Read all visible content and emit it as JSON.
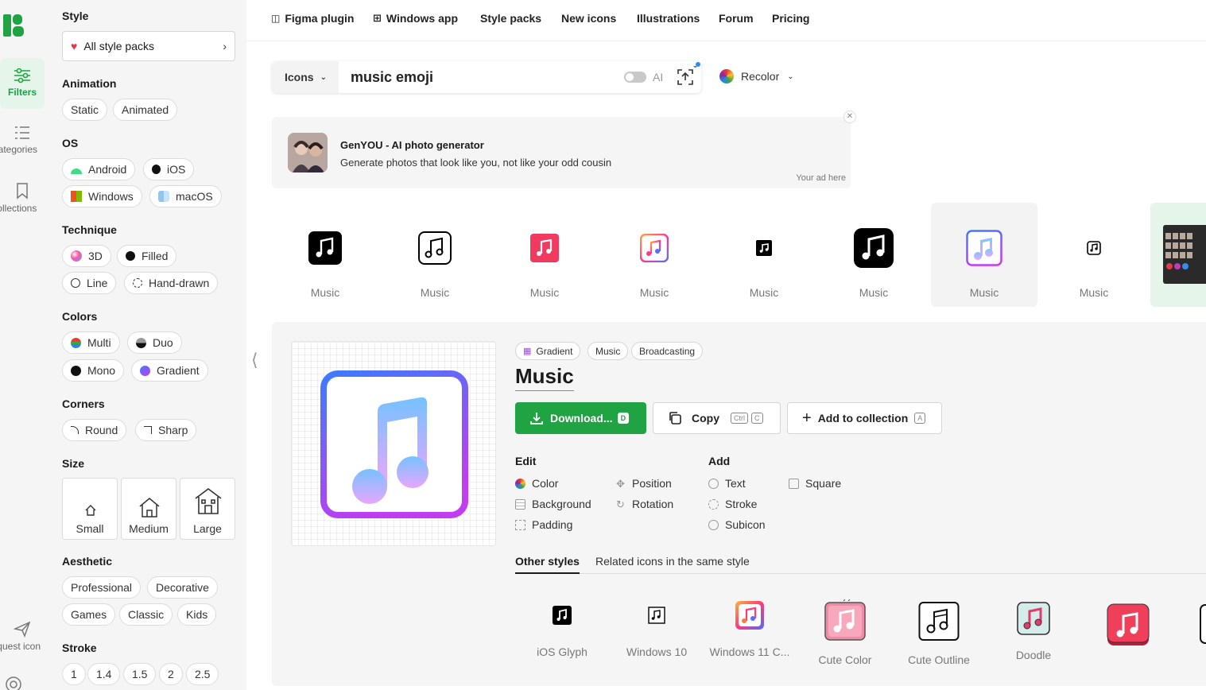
{
  "rail": {
    "items": [
      {
        "label": "Filters",
        "icon": "sliders-icon"
      },
      {
        "label": "Categories",
        "icon": "list-icon"
      },
      {
        "label": "Collections",
        "icon": "bookmark-icon"
      },
      {
        "label": "Request icon",
        "icon": "send-icon"
      }
    ]
  },
  "sidebar": {
    "style_title": "Style",
    "style_pack": "All style packs",
    "animation_title": "Animation",
    "animation": [
      "Static",
      "Animated"
    ],
    "os_title": "OS",
    "os": [
      "Android",
      "iOS",
      "Windows",
      "macOS"
    ],
    "technique_title": "Technique",
    "technique": [
      "3D",
      "Filled",
      "Line",
      "Hand-drawn"
    ],
    "colors_title": "Colors",
    "colors": [
      "Multi",
      "Duo",
      "Mono",
      "Gradient"
    ],
    "corners_title": "Corners",
    "corners": [
      "Round",
      "Sharp"
    ],
    "size_title": "Size",
    "size": [
      "Small",
      "Medium",
      "Large"
    ],
    "aesthetic_title": "Aesthetic",
    "aesthetic": [
      "Professional",
      "Decorative",
      "Games",
      "Classic",
      "Kids"
    ],
    "stroke_title": "Stroke",
    "stroke": [
      "1",
      "1.4",
      "1.5",
      "2",
      "2.5"
    ]
  },
  "nav": {
    "links": [
      "Figma plugin",
      "Windows app",
      "Style packs",
      "New icons",
      "Illustrations",
      "Forum",
      "Pricing"
    ]
  },
  "search": {
    "type": "Icons",
    "query": "music emoji",
    "ai_label": "AI",
    "recolor": "Recolor"
  },
  "ad": {
    "title": "GenYOU - AI photo generator",
    "text": "Generate photos that look like you, not like your odd cousin",
    "footer": "Your ad here"
  },
  "results": {
    "labels": [
      "Music",
      "Music",
      "Music",
      "Music",
      "Music",
      "Music",
      "Music",
      "Music"
    ],
    "selected_index": 6
  },
  "detail": {
    "tags": [
      "Gradient",
      "Music",
      "Broadcasting"
    ],
    "title": "Music",
    "download": "Download...",
    "download_key": "D",
    "copy": "Copy",
    "copy_key_1": "Ctrl",
    "copy_key_2": "C",
    "add_collection": "Add to collection",
    "add_key": "A",
    "edit_title": "Edit",
    "edit_items": [
      "Color",
      "Background",
      "Padding",
      "Position",
      "Rotation"
    ],
    "add_title": "Add",
    "add_items": [
      "Text",
      "Stroke",
      "Subicon",
      "Square"
    ],
    "subtabs": [
      "Other styles",
      "Related icons in the same style"
    ],
    "other_styles": [
      "iOS Glyph",
      "Windows 10",
      "Windows 11 C...",
      "Cute Color",
      "Cute Outline",
      "Doodle"
    ]
  },
  "colors": {
    "brand_green": "#1fa343",
    "gradient_start": "#3d7bff",
    "gradient_end": "#c23cf0"
  }
}
